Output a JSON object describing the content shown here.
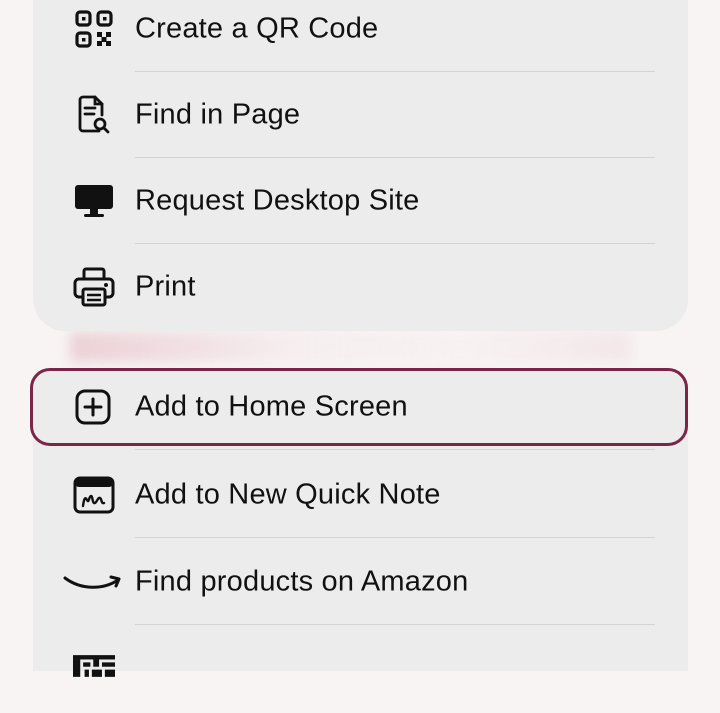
{
  "menu_top": {
    "items": [
      {
        "label": "Create a QR Code",
        "icon": "qr-code-icon"
      },
      {
        "label": "Find in Page",
        "icon": "find-in-page-icon"
      },
      {
        "label": "Request Desktop Site",
        "icon": "desktop-icon"
      },
      {
        "label": "Print",
        "icon": "printer-icon"
      }
    ]
  },
  "menu_bottom": {
    "items": [
      {
        "label": "Add to Home Screen",
        "icon": "plus-square-icon",
        "highlighted": true
      },
      {
        "label": "Add to New Quick Note",
        "icon": "quick-note-icon"
      },
      {
        "label": "Find products on Amazon",
        "icon": "amazon-smile-icon"
      }
    ]
  },
  "colors": {
    "highlight_border": "#7a2646",
    "menu_background": "#ececec",
    "page_background": "#f8f4f4"
  }
}
